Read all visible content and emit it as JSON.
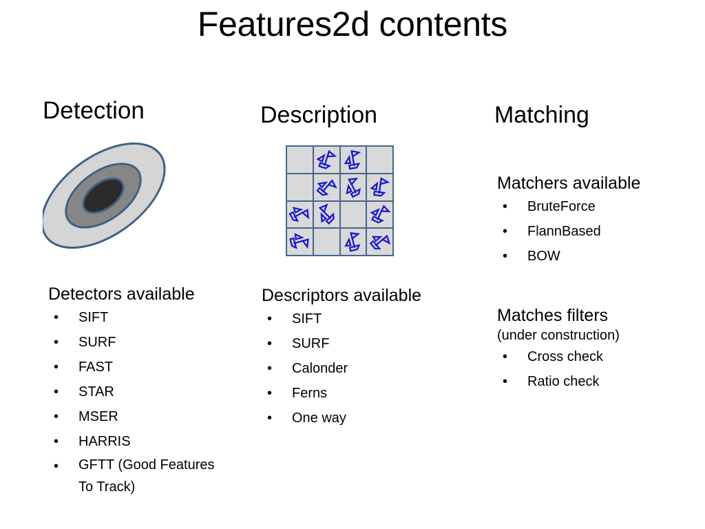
{
  "slide": {
    "title": "Features2d contents",
    "accent_blue": "#1a1ad0",
    "grid_border_blue": "#45658f",
    "grid_cell_gray": "#d9d9d9",
    "ellipse_outer_gray": "#d5d5d5",
    "ellipse_middle_gray": "#868686",
    "ellipse_inner_dark": "#2b2b2b",
    "bullet_glyph": "•"
  },
  "columns": {
    "detection": {
      "heading": "Detection",
      "graphic_name": "nested-ellipse-keypoint-illustration",
      "subheading": "Detectors available",
      "items": [
        "SIFT",
        "SURF",
        "FAST",
        "STAR",
        "MSER",
        "HARRIS",
        "GFTT (Good Features\nTo Track)"
      ]
    },
    "description": {
      "heading": "Description",
      "graphic_name": "gradient-orientation-grid",
      "grid": {
        "rows": 4,
        "cols": 4,
        "filled_cells": [
          [
            false,
            true,
            true,
            false
          ],
          [
            false,
            true,
            true,
            true
          ],
          [
            true,
            true,
            false,
            true
          ],
          [
            true,
            false,
            true,
            true
          ]
        ]
      },
      "subheading": "Descriptors available",
      "items": [
        "SIFT",
        "SURF",
        "Calonder",
        "Ferns",
        "One way"
      ]
    },
    "matching": {
      "heading": "Matching",
      "matchers_subheading": "Matchers available",
      "matchers": [
        "BruteForce",
        "FlannBased",
        "BOW"
      ],
      "filters_subheading": "Matches filters",
      "filters_note": "(under construction)",
      "filters": [
        "Cross check",
        "Ratio check"
      ]
    }
  }
}
